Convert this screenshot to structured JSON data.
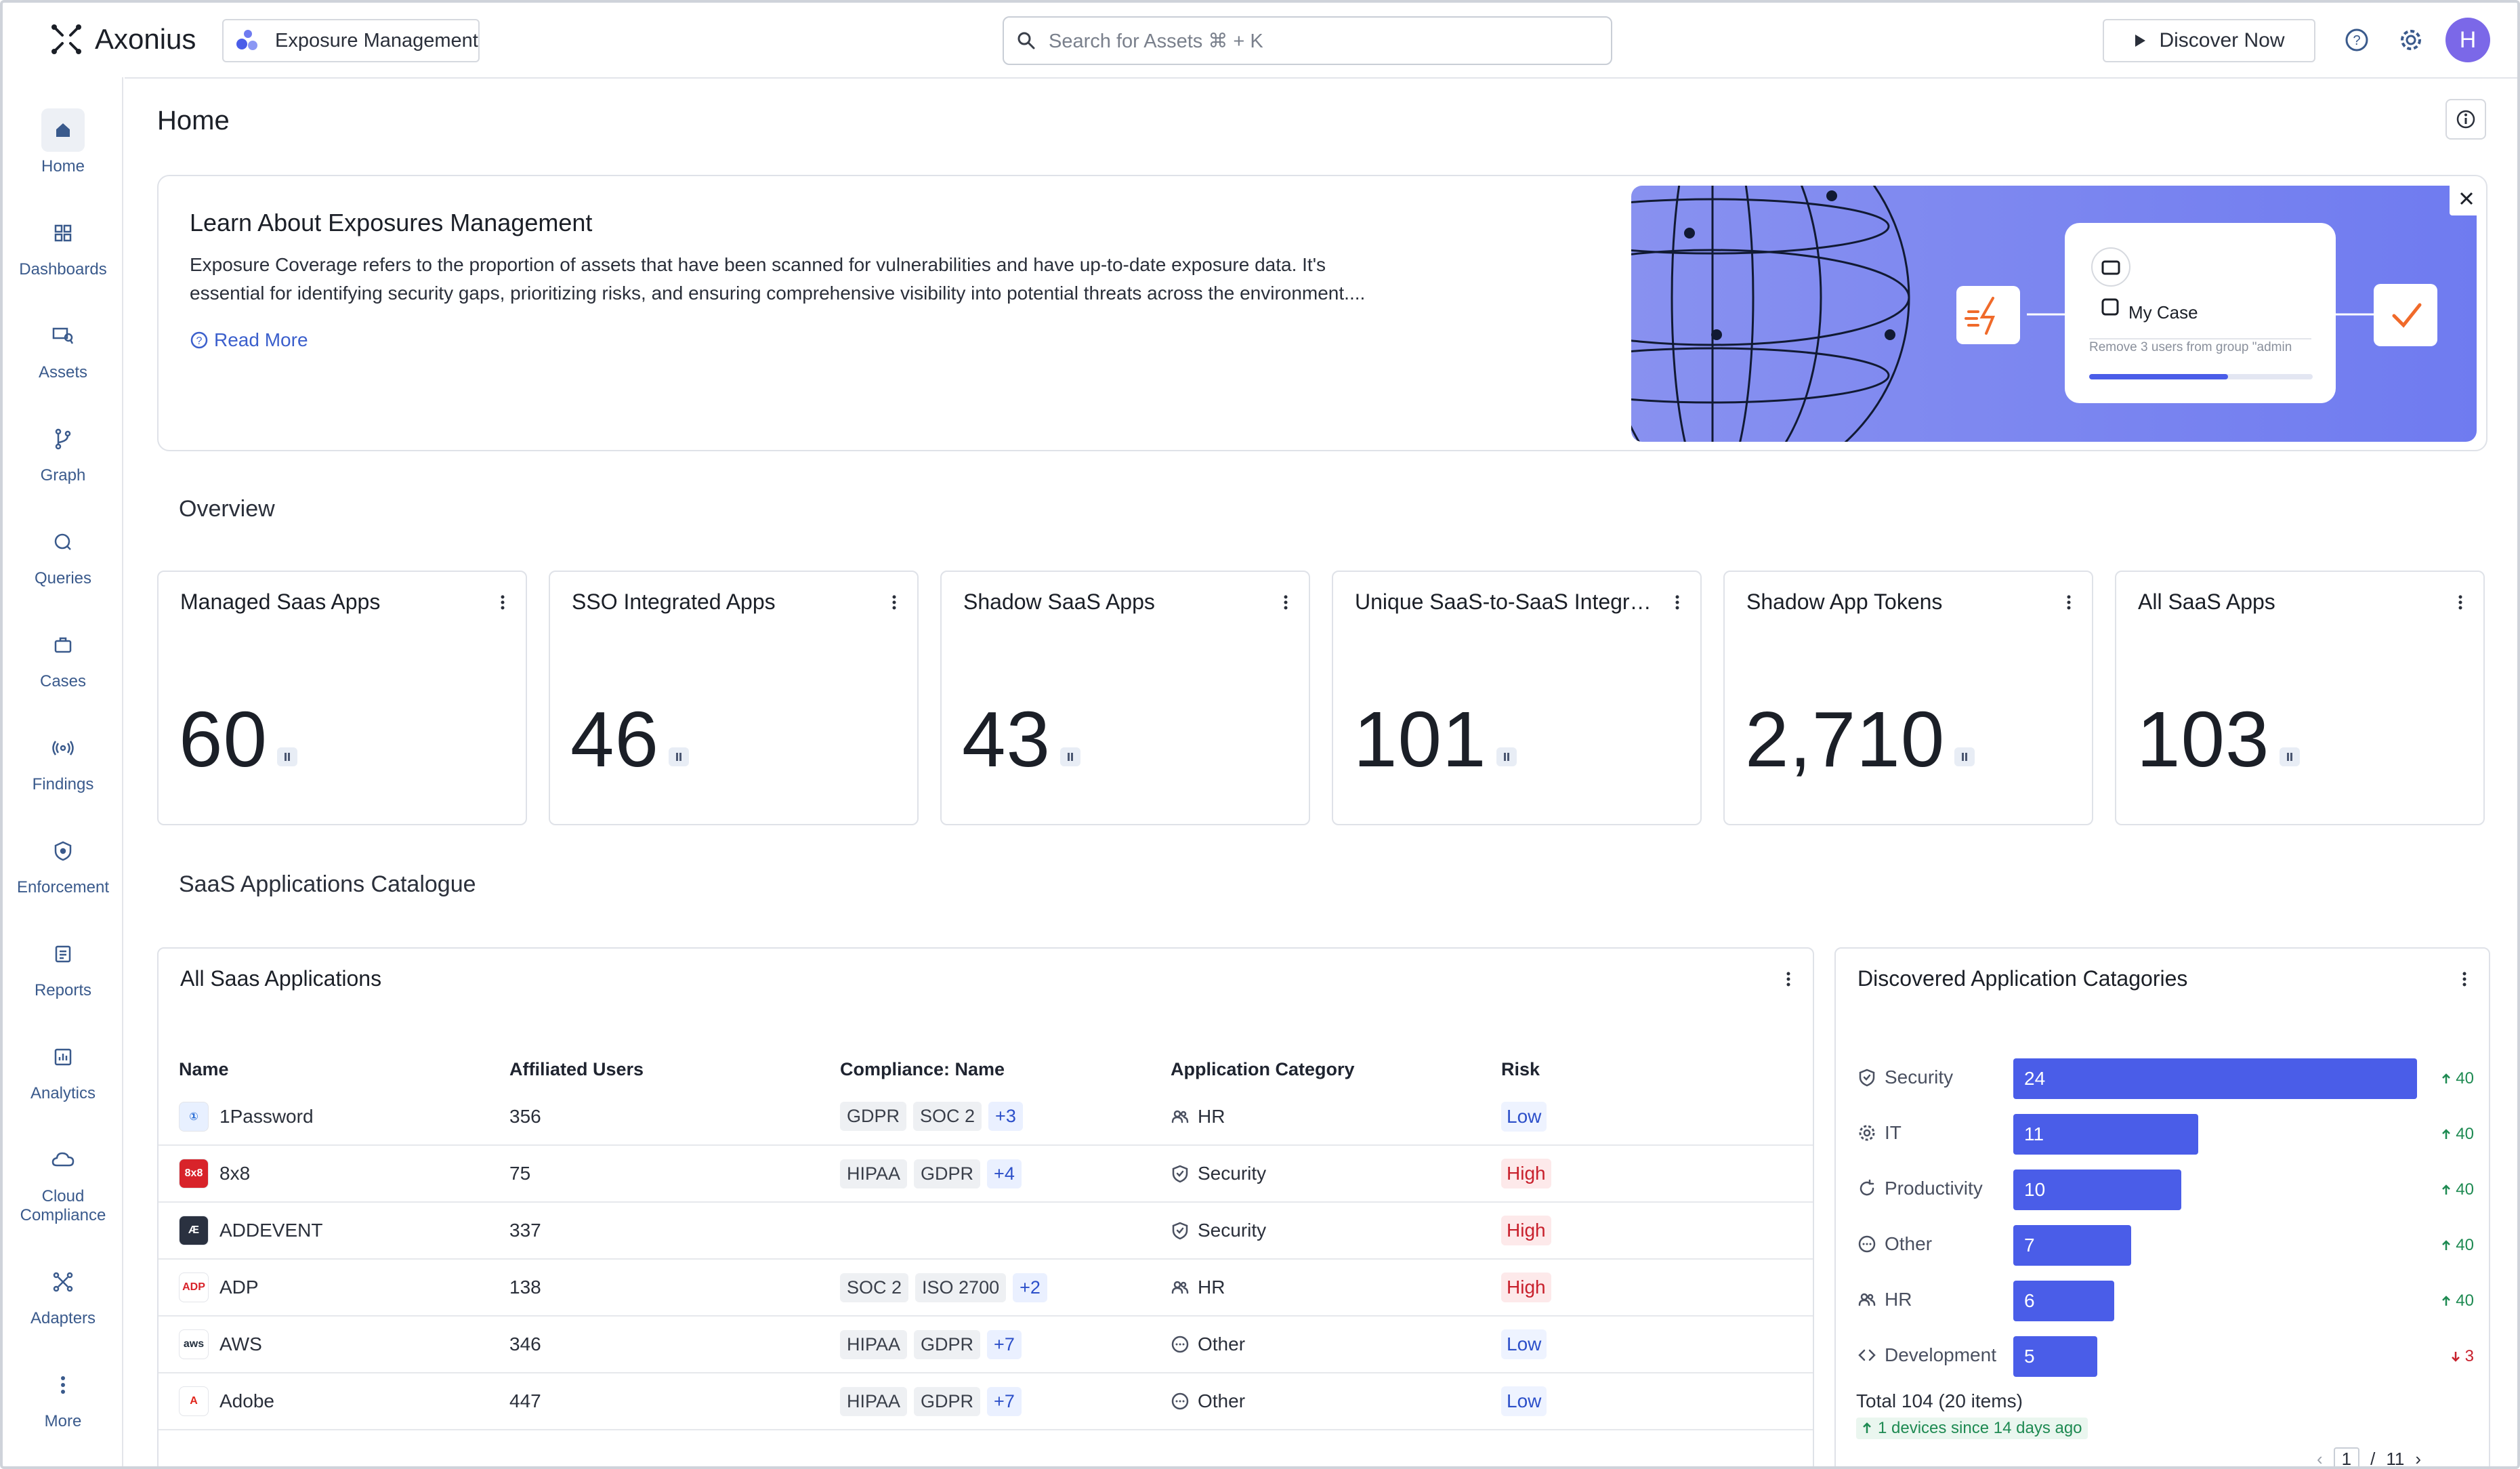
{
  "brand": {
    "name": "Axonius",
    "product": "Exposure Management"
  },
  "search": {
    "placeholder": "Search for Assets ⌘ + K"
  },
  "header": {
    "discover_label": "Discover Now",
    "avatar_initial": "H"
  },
  "sidebar": {
    "items": [
      {
        "label": "Home",
        "icon": "home-icon"
      },
      {
        "label": "Dashboards",
        "icon": "dashboards-icon"
      },
      {
        "label": "Assets",
        "icon": "assets-icon"
      },
      {
        "label": "Graph",
        "icon": "graph-icon"
      },
      {
        "label": "Queries",
        "icon": "queries-icon"
      },
      {
        "label": "Cases",
        "icon": "cases-icon"
      },
      {
        "label": "Findings",
        "icon": "findings-icon"
      },
      {
        "label": "Enforcement",
        "icon": "enforcement-icon"
      },
      {
        "label": "Reports",
        "icon": "reports-icon"
      },
      {
        "label": "Analytics",
        "icon": "analytics-icon"
      },
      {
        "label": "Cloud Compliance",
        "icon": "cloud-icon"
      },
      {
        "label": "Adapters",
        "icon": "adapters-icon"
      },
      {
        "label": "More",
        "icon": "more-icon"
      }
    ]
  },
  "page": {
    "title": "Home"
  },
  "banner": {
    "title": "Learn About Exposures Management",
    "text": "Exposure Coverage refers to the proportion of assets that have been scanned for vulnerabilities and have up-to-date exposure data. It's essential for identifying security gaps, prioritizing risks, and ensuring comprehensive visibility into potential threats across the environment....",
    "read_more": "Read More",
    "case_card": {
      "title": "My Case",
      "subtitle": "Remove 3 users from group \"admin",
      "progress": 0.62
    }
  },
  "overview": {
    "title": "Overview",
    "cards": [
      {
        "title": "Managed Saas Apps",
        "value": "60"
      },
      {
        "title": "SSO Integrated Apps",
        "value": "46"
      },
      {
        "title": "Shadow SaaS Apps",
        "value": "43"
      },
      {
        "title": "Unique SaaS-to-SaaS Integrati...",
        "value": "101"
      },
      {
        "title": "Shadow App Tokens",
        "value": "2,710"
      },
      {
        "title": "All SaaS Apps",
        "value": "103"
      }
    ]
  },
  "catalogue": {
    "title": "SaaS Applications Catalogue",
    "table": {
      "title": "All Saas Applications",
      "columns": [
        "Name",
        "Affiliated Users",
        "Compliance: Name",
        "Application Category",
        "Risk"
      ],
      "rows": [
        {
          "name": "1Password",
          "users": "356",
          "tags": [
            "GDPR",
            "SOC 2"
          ],
          "more": "+3",
          "category": "HR",
          "cat_icon": "users",
          "risk": "Low",
          "logo_bg": "#e8f0ff",
          "logo_fg": "#2c6fd6",
          "logo_txt": "①"
        },
        {
          "name": "8x8",
          "users": "75",
          "tags": [
            "HIPAA",
            "GDPR"
          ],
          "more": "+4",
          "category": "Security",
          "cat_icon": "shield",
          "risk": "High",
          "logo_bg": "#d8232a",
          "logo_fg": "#ffffff",
          "logo_txt": "8x8"
        },
        {
          "name": "ADDEVENT",
          "users": "337",
          "tags": [],
          "more": "",
          "category": "Security",
          "cat_icon": "shield",
          "risk": "High",
          "logo_bg": "#2a3140",
          "logo_fg": "#ffffff",
          "logo_txt": "Æ"
        },
        {
          "name": "ADP",
          "users": "138",
          "tags": [
            "SOC 2",
            "ISO 2700"
          ],
          "more": "+2",
          "category": "HR",
          "cat_icon": "users",
          "risk": "High",
          "logo_bg": "#ffffff",
          "logo_fg": "#d8232a",
          "logo_txt": "ADP"
        },
        {
          "name": "AWS",
          "users": "346",
          "tags": [
            "HIPAA",
            "GDPR"
          ],
          "more": "+7",
          "category": "Other",
          "cat_icon": "other",
          "risk": "Low",
          "logo_bg": "#ffffff",
          "logo_fg": "#232f3e",
          "logo_txt": "aws"
        },
        {
          "name": "Adobe",
          "users": "447",
          "tags": [
            "HIPAA",
            "GDPR"
          ],
          "more": "+7",
          "category": "Other",
          "cat_icon": "other",
          "risk": "Low",
          "logo_bg": "#ffffff",
          "logo_fg": "#e1251b",
          "logo_txt": "A"
        }
      ]
    },
    "categories": {
      "title": "Discovered Application Catagories",
      "items": [
        {
          "label": "Security",
          "value": 24,
          "delta": "40",
          "dir": "up",
          "icon": "shield"
        },
        {
          "label": "IT",
          "value": 11,
          "delta": "40",
          "dir": "up",
          "icon": "gear"
        },
        {
          "label": "Productivity",
          "value": 10,
          "delta": "40",
          "dir": "up",
          "icon": "refresh"
        },
        {
          "label": "Other",
          "value": 7,
          "delta": "40",
          "dir": "up",
          "icon": "other"
        },
        {
          "label": "HR",
          "value": 6,
          "delta": "40",
          "dir": "up",
          "icon": "users"
        },
        {
          "label": "Development",
          "value": 5,
          "delta": "3",
          "dir": "down",
          "icon": "code"
        }
      ],
      "max": 24,
      "total": "Total 104 (20 items)",
      "since": "1 devices since 14 days ago",
      "pager": {
        "current": "1",
        "sep": "/",
        "total": "11"
      }
    }
  },
  "colors": {
    "accent": "#4a5de8",
    "avatar": "#7b68e8",
    "high": "#c8202c",
    "low": "#2c4fc9"
  }
}
